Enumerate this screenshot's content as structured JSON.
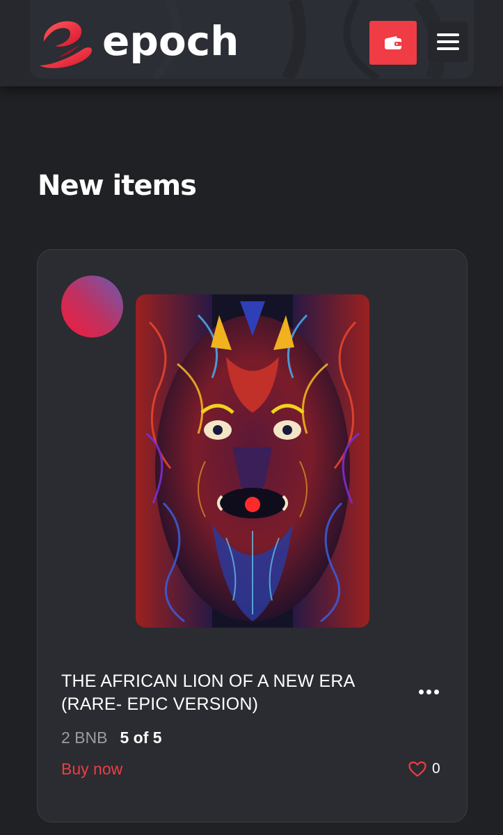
{
  "header": {
    "brand": "epoch",
    "colors": {
      "accent": "#ef3c45",
      "header_bg": "#26282d"
    },
    "icons": {
      "logo": "epoch-logo-icon",
      "wallet": "wallet-icon",
      "menu": "hamburger-menu-icon"
    }
  },
  "section": {
    "title": "New items"
  },
  "item": {
    "title": "THE AFRICAN LION OF A NEW ERA (RARE- EPIC VERSION)",
    "price": "2 BNB",
    "availability": "5 of 5",
    "buy_label": "Buy now",
    "likes": "0",
    "icons": {
      "more": "more-dots-icon",
      "like": "heart-icon"
    }
  }
}
